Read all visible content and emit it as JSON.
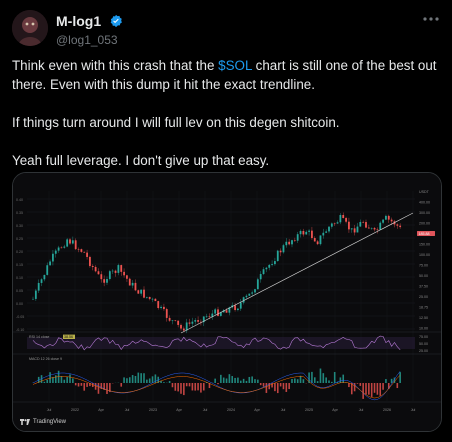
{
  "author": {
    "display_name": "M-log1",
    "handle": "@log1_053",
    "verified": true
  },
  "tweet": {
    "line1_before": "Think even with this crash that the ",
    "cashtag": "$SOL",
    "line1_after": " chart is still one of the best out there. Even with this dump it hit the exact trendline.",
    "paragraph2": "If things turn around I will full lev on this degen shitcoin.",
    "paragraph3": "Yeah full leverage. I don't give up that easy."
  },
  "chart": {
    "header": "Blog1 created with TradingView.com, Oct 18, 2025 16:10 UTC+2",
    "symbol_line": "SOL / TetherUS · 3D · Binance",
    "ohlc": "O 195.22  H 197.65  L 185.41  C 185.88  -9.44 (-4.80%)",
    "price_axis": [
      "USDT",
      "400.00",
      "300.00",
      "200.00",
      "185.88",
      "150.00",
      "100.00",
      "75.00",
      "50.00",
      "37.50",
      "25.00",
      "18.75",
      "12.50",
      "10.00"
    ],
    "left_axis": [
      "0.40",
      "0.35",
      "0.30",
      "0.25",
      "0.20",
      "0.15",
      "0.10",
      "0.05",
      "0.00",
      "-0.05",
      "-0.10"
    ],
    "rsi_label": "RSI 14 close",
    "rsi_value": "38.56",
    "rsi_axis": [
      "75.00",
      "50.00",
      "25.00"
    ],
    "macd_label": "MACD 12 26 close 9",
    "time_axis": [
      "Jul",
      "2022",
      "Apr",
      "Jul",
      "2023",
      "Apr",
      "Jul",
      "2024",
      "Apr",
      "Jul",
      "2025",
      "Apr",
      "Jul",
      "2026",
      "Jul"
    ],
    "brand": "TradingView",
    "colors": {
      "up": "#26a69a",
      "down": "#ef5350",
      "rsi": "#b87bd8",
      "trendline": "#cfcfcf",
      "price_tag": "#e0555b"
    }
  }
}
